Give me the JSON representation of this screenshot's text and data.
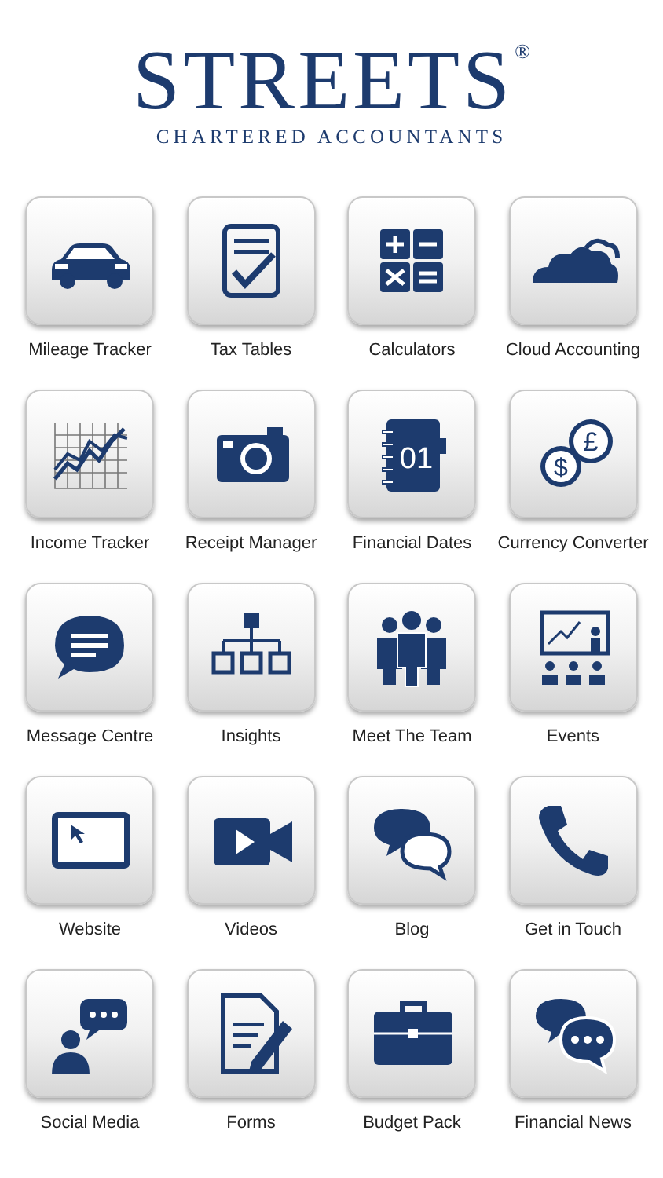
{
  "logo": {
    "name": "STREETS",
    "mark": "®",
    "tagline": "CHARTERED ACCOUNTANTS"
  },
  "tiles": [
    {
      "label": "Mileage Tracker",
      "kind": "car"
    },
    {
      "label": "Tax Tables",
      "kind": "checklist"
    },
    {
      "label": "Calculators",
      "kind": "calculator"
    },
    {
      "label": "Cloud Accounting",
      "kind": "cloud"
    },
    {
      "label": "Income Tracker",
      "kind": "chart"
    },
    {
      "label": "Receipt Manager",
      "kind": "camera"
    },
    {
      "label": "Financial Dates",
      "kind": "notebook",
      "glyphs": [
        "01"
      ]
    },
    {
      "label": "Currency Converter",
      "kind": "coins",
      "glyphs": [
        "$",
        "£"
      ]
    },
    {
      "label": "Message Centre",
      "kind": "message"
    },
    {
      "label": "Insights",
      "kind": "org"
    },
    {
      "label": "Meet The Team",
      "kind": "team"
    },
    {
      "label": "Events",
      "kind": "presentation"
    },
    {
      "label": "Website",
      "kind": "monitor"
    },
    {
      "label": "Videos",
      "kind": "video"
    },
    {
      "label": "Blog",
      "kind": "bubbles"
    },
    {
      "label": "Get in Touch",
      "kind": "phone"
    },
    {
      "label": "Social Media",
      "kind": "social"
    },
    {
      "label": "Forms",
      "kind": "forms"
    },
    {
      "label": "Budget Pack",
      "kind": "briefcase"
    },
    {
      "label": "Financial News",
      "kind": "news"
    }
  ]
}
